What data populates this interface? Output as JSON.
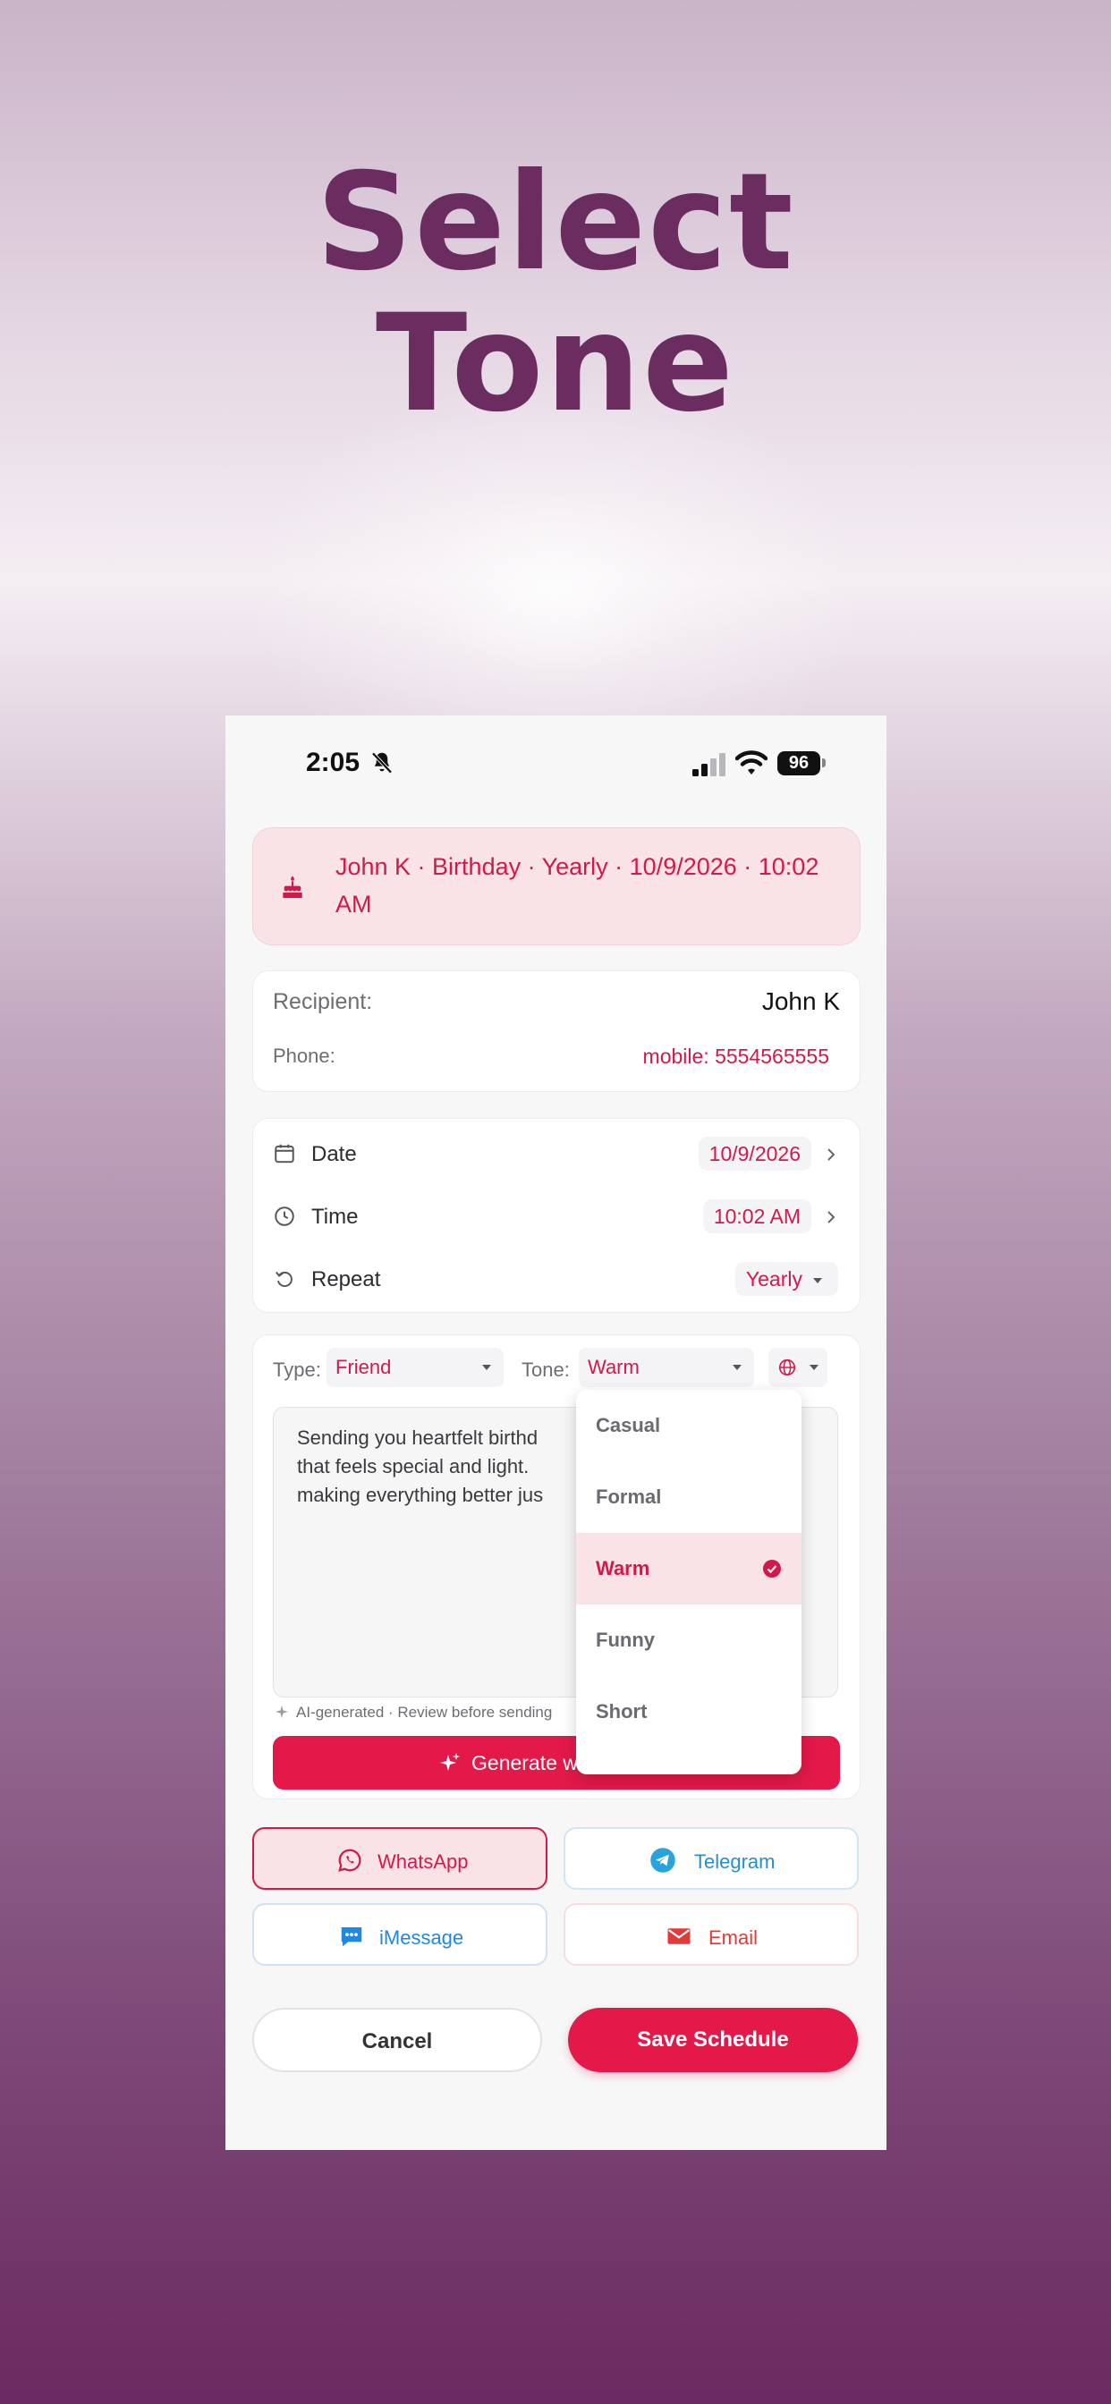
{
  "hero": {
    "line1": "Select",
    "line2": "Tone"
  },
  "status_bar": {
    "time": "2:05",
    "battery": "96"
  },
  "summary": {
    "text": "John K · Birthday · Yearly · 10/9/2026 · 10:02 AM",
    "icon": "cake-icon"
  },
  "recipient": {
    "label": "Recipient:",
    "value": "John K",
    "phone_label": "Phone:",
    "phone_value": "mobile: 5554565555"
  },
  "schedule": {
    "date_label": "Date",
    "date_value": "10/9/2026",
    "time_label": "Time",
    "time_value": "10:02 AM",
    "repeat_label": "Repeat",
    "repeat_value": "Yearly"
  },
  "compose": {
    "type_label": "Type:",
    "type_value": "Friend",
    "tone_label": "Tone:",
    "tone_value": "Warm",
    "language_icon": "globe-icon",
    "message_line1": "Sending you heartfelt birthd",
    "message_line2": "that feels special and light. ",
    "message_line3": "making everything better jus",
    "ai_note": "AI-generated · Review before sending",
    "generate_label": "Generate w"
  },
  "tone_dropdown": {
    "options": [
      "Casual",
      "Formal",
      "Warm",
      "Funny",
      "Short"
    ],
    "selected": "Warm"
  },
  "channels": {
    "whatsapp": "WhatsApp",
    "telegram": "Telegram",
    "imessage": "iMessage",
    "email": "Email"
  },
  "actions": {
    "cancel": "Cancel",
    "save": "Save Schedule"
  },
  "colors": {
    "accent": "#e3194a",
    "accent_text": "#d11a4a",
    "summary_bg": "#f9e3e7",
    "hero": "#6b2d5f",
    "telegram": "#2aa3dc",
    "imessage": "#1e88e5",
    "email": "#e53935"
  }
}
